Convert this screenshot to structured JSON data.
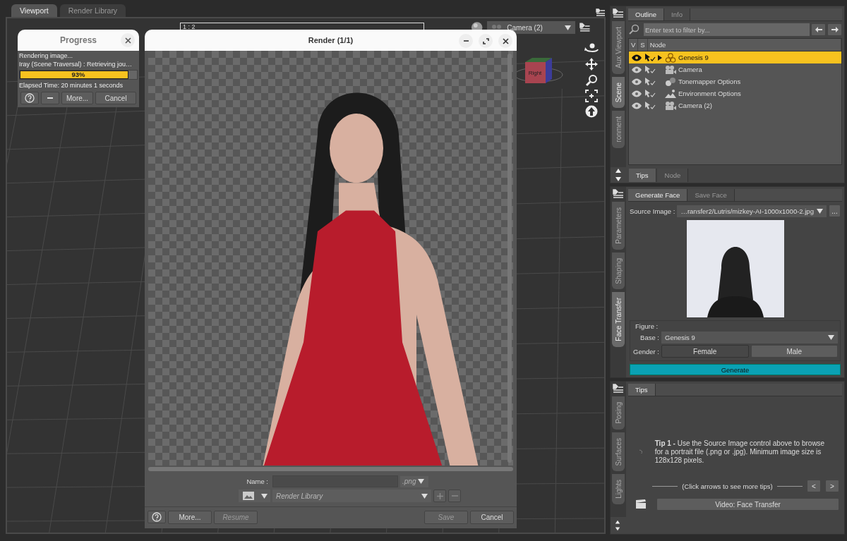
{
  "viewport_tabs": [
    {
      "label": "Viewport",
      "selected": true
    },
    {
      "label": "Render Library",
      "selected": false
    }
  ],
  "viewport": {
    "ratio": "1 : 2",
    "camera": "Camera (2)",
    "cube_face": "Right"
  },
  "progress": {
    "title": "Progress",
    "status": "Rendering image...",
    "detail": "Iray (Scene Traversal) : Retrieving jou…",
    "level": 0.93,
    "percent": "93%",
    "elapsed": "Elapsed Time: 20 minutes 1 seconds",
    "more": "More...",
    "cancel": "Cancel"
  },
  "render": {
    "title": "Render (1/1)",
    "name_label": "Name :",
    "format": {
      "value": ".png",
      "disabled": true
    },
    "library": {
      "placeholder": "Render Library"
    },
    "left_buttons": [
      {
        "label": "More...",
        "disabled": false
      },
      {
        "label": "Resume",
        "disabled": true
      }
    ],
    "right_buttons": [
      {
        "label": "Save",
        "disabled": true
      },
      {
        "label": "Cancel",
        "disabled": false
      }
    ]
  },
  "scene_pane": {
    "side_tabs": [
      {
        "label": "Aux Viewport",
        "selected": false
      },
      {
        "label": "Scene",
        "selected": true
      },
      {
        "label": "ronment",
        "selected": false
      }
    ],
    "tabs": [
      {
        "label": "Outline",
        "selected": true
      },
      {
        "label": "Info",
        "selected": false
      }
    ],
    "filter": {
      "placeholder": "Enter text to filter by..."
    },
    "columns": [
      "V",
      "S",
      "Node"
    ],
    "rows": [
      {
        "label": "Genesis 9",
        "kind": "figure",
        "selected": true,
        "expandable": true
      },
      {
        "label": "Camera",
        "kind": "camera",
        "selected": false,
        "expandable": false
      },
      {
        "label": "Tonemapper Options",
        "kind": "tonemapper",
        "selected": false,
        "expandable": false
      },
      {
        "label": "Environment Options",
        "kind": "environment",
        "selected": false,
        "expandable": false
      },
      {
        "label": "Camera (2)",
        "kind": "camera",
        "selected": false,
        "expandable": false
      }
    ],
    "bottom_tabs": [
      {
        "label": "Tips",
        "selected": true
      },
      {
        "label": "Node",
        "selected": false
      }
    ]
  },
  "face_pane": {
    "side_tabs": [
      {
        "label": "Parameters",
        "selected": false
      },
      {
        "label": "Shaping",
        "selected": false
      },
      {
        "label": "Face Transfer",
        "selected": true
      }
    ],
    "tabs": [
      {
        "label": "Generate Face",
        "selected": true
      },
      {
        "label": "Save Face",
        "selected": false
      }
    ],
    "source_label": "Source Image :",
    "source_value": "…ransfer2/Lutris/mizkey-AI-1000x1000-2.jpg",
    "browse": "...",
    "figure_label": "Figure :",
    "base_label": "Base :",
    "base_value": "Genesis 9",
    "gender_label": "Gender :",
    "genders": [
      {
        "label": "Female",
        "selected": true
      },
      {
        "label": "Male",
        "selected": false
      }
    ],
    "generate": "Generate"
  },
  "tips_pane": {
    "side_tabs": [
      {
        "label": "Posing",
        "selected": false
      },
      {
        "label": "Surfaces",
        "selected": false
      },
      {
        "label": "Lights",
        "selected": false
      }
    ],
    "tabs": [
      {
        "label": "Tips",
        "selected": true
      }
    ],
    "tip": "**Tip 1 -** Use the Source Image control above to browse for a portrait file (.png or .jpg). Minimum image size is 128x128 pixels.",
    "hint": "(Click arrows to see more tips)",
    "prev": "<",
    "next": ">",
    "video": "Video: Face Transfer"
  }
}
